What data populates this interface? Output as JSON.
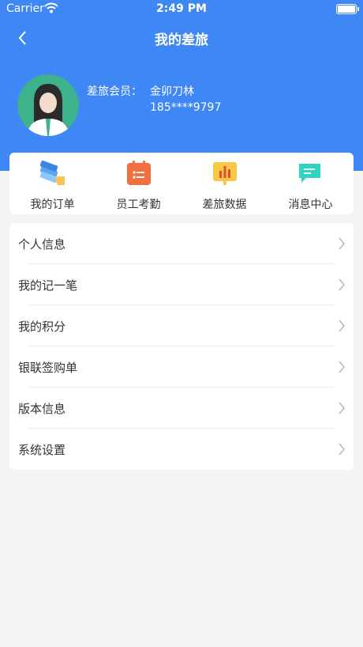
{
  "status_bar": {
    "carrier": "Carrier",
    "time": "2:49 PM",
    "wifi_icon": "wifi-icon",
    "battery_icon": "battery-icon"
  },
  "nav": {
    "title": "我的差旅",
    "back_icon": "chevron-left-icon"
  },
  "profile": {
    "label": "差旅会员：",
    "name": "金卯刀林",
    "phone": "185****9797",
    "avatar_icon": "avatar-female-icon"
  },
  "quick_actions": [
    {
      "label": "我的订单",
      "icon": "orders-icon"
    },
    {
      "label": "员工考勤",
      "icon": "attendance-calendar-icon"
    },
    {
      "label": "差旅数据",
      "icon": "data-chart-icon"
    },
    {
      "label": "消息中心",
      "icon": "message-icon"
    }
  ],
  "menu": [
    {
      "label": "个人信息"
    },
    {
      "label": "我的记一笔"
    },
    {
      "label": "我的积分"
    },
    {
      "label": "银联签购单"
    },
    {
      "label": "版本信息"
    },
    {
      "label": "系统设置"
    }
  ],
  "colors": {
    "primary": "#3e87f5",
    "background": "#f4f4f4",
    "card": "#ffffff"
  }
}
